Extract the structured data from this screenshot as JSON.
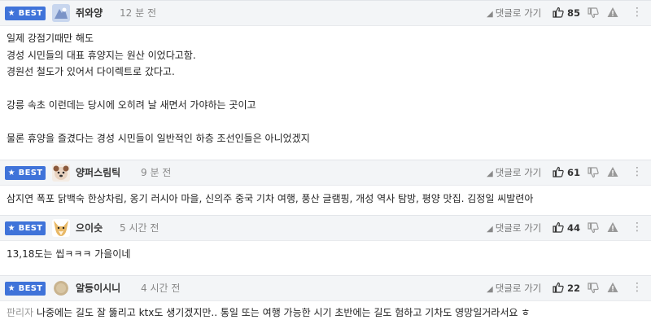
{
  "comments": [
    {
      "badge": "★ BEST",
      "nickname": "쥐와양",
      "time": "12 분 전",
      "reply_label": "댓글로 가기",
      "upvotes": "85",
      "lines": [
        "일제 강점기때만 해도",
        "경성 시민들의 대표 휴양지는 원산 이었다고함.",
        "경원선 철도가 있어서 다이렉트로 갔다고.",
        "",
        "강릉 속초 이런데는 당시에 오히려 날 새면서 가야하는 곳이고",
        "",
        "물론 휴양을 즐겼다는 경성 시민들이 일반적인 하층 조선인들은 아니었겠지"
      ]
    },
    {
      "badge": "★ BEST",
      "nickname": "양퍼스림틱",
      "time": "9 분 전",
      "reply_label": "댓글로 가기",
      "upvotes": "61",
      "lines": [
        "삼지연 폭포 닭백숙 한상차림, 옹기 러시아 마을, 신의주 중국 기차 여행, 풍산 글램핑, 개성 역사 탐방, 평양 맛집. 김정일 씨발련아"
      ]
    },
    {
      "badge": "★ BEST",
      "nickname": "으이슷",
      "time": "5 시간 전",
      "reply_label": "댓글로 가기",
      "upvotes": "44",
      "lines": [
        "13,18도는 씹ㅋㅋㅋ 가을이네"
      ]
    },
    {
      "badge": "★ BEST",
      "nickname": "알등이시니",
      "time": "4 시간 전",
      "reply_label": "댓글로 가기",
      "upvotes": "22",
      "prefix": "판리자",
      "lines": [
        "나중에는 길도 잘 뚫리고 ktx도 생기겠지만.. 통일 또는 여행 가능한 시기 초반에는 길도 험하고 기차도 영망일거라서요 ㅎ"
      ]
    }
  ],
  "colors": {
    "badge": "#3f73d9",
    "header_bg": "#f3f5f7"
  },
  "icons": [
    "reply-arrow-icon",
    "thumb-up-icon",
    "thumb-down-icon",
    "report-icon",
    "more-icon"
  ]
}
